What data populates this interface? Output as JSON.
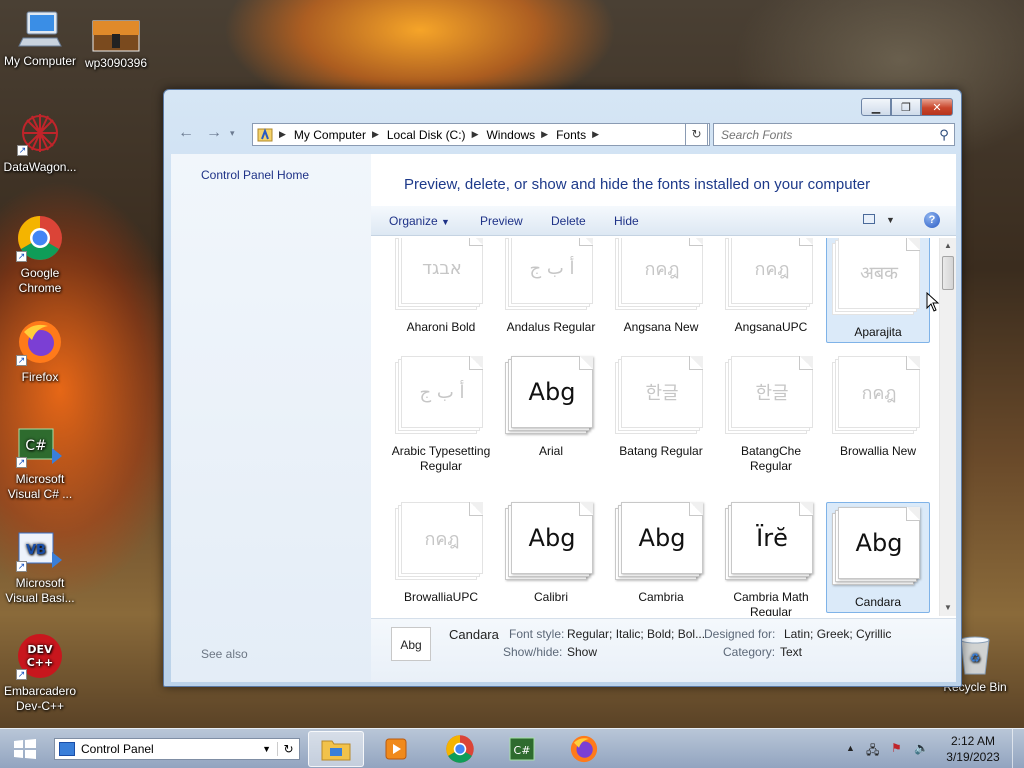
{
  "desktop": {
    "icons": [
      {
        "label": "My Computer"
      },
      {
        "label": "wp3090396"
      },
      {
        "label": "DataWagon..."
      },
      {
        "label": "Google Chrome"
      },
      {
        "label": "Firefox"
      },
      {
        "label": "Microsoft Visual C# ..."
      },
      {
        "label": "Microsoft Visual Basi..."
      },
      {
        "label": "Embarcadero Dev-C++"
      },
      {
        "label": "Recycle Bin"
      }
    ]
  },
  "window": {
    "breadcrumb": [
      "My Computer",
      "Local Disk (C:)",
      "Windows",
      "Fonts"
    ],
    "search_placeholder": "Search Fonts",
    "sidebar": {
      "home_link": "Control Panel Home",
      "see_also": "See also"
    },
    "heading": "Preview, delete, or show and hide the fonts installed on your computer",
    "toolbar": {
      "organize": "Organize",
      "preview": "Preview",
      "delete": "Delete",
      "hide": "Hide"
    },
    "fonts": [
      {
        "name": "Aharoni Bold",
        "sample": "אבגד",
        "hidden": true
      },
      {
        "name": "Andalus Regular",
        "sample": "أ ب ج",
        "hidden": true
      },
      {
        "name": "Angsana New",
        "sample": "กคฎ",
        "hidden": true
      },
      {
        "name": "AngsanaUPC",
        "sample": "กคฎ",
        "hidden": true
      },
      {
        "name": "Aparajita",
        "sample": "अबक",
        "hidden": true
      },
      {
        "name": "Arabic Typesetting Regular",
        "sample": "أ ب ج",
        "hidden": true
      },
      {
        "name": "Arial",
        "sample": "Abg",
        "hidden": false
      },
      {
        "name": "Batang Regular",
        "sample": "한글",
        "hidden": true
      },
      {
        "name": "BatangChe Regular",
        "sample": "한글",
        "hidden": true
      },
      {
        "name": "Browallia New",
        "sample": "กคฎ",
        "hidden": true
      },
      {
        "name": "BrowalliaUPC",
        "sample": "กคฎ",
        "hidden": true
      },
      {
        "name": "Calibri",
        "sample": "Abg",
        "hidden": false
      },
      {
        "name": "Cambria",
        "sample": "Abg",
        "hidden": false
      },
      {
        "name": "Cambria Math Regular",
        "sample": "Ïrĕ",
        "hidden": false
      },
      {
        "name": "Candara",
        "sample": "Abg",
        "hidden": false
      }
    ],
    "details": {
      "name": "Candara",
      "thumb_sample": "Abg",
      "font_style_label": "Font style:",
      "font_style_value": "Regular; Italic; Bold; Bol...",
      "designed_for_label": "Designed for:",
      "designed_for_value": "Latin; Greek; Cyrillic",
      "show_hide_label": "Show/hide:",
      "show_hide_value": "Show",
      "category_label": "Category:",
      "category_value": "Text"
    }
  },
  "taskbar": {
    "address_value": "Control Panel",
    "time": "2:12 AM",
    "date": "3/19/2023"
  }
}
